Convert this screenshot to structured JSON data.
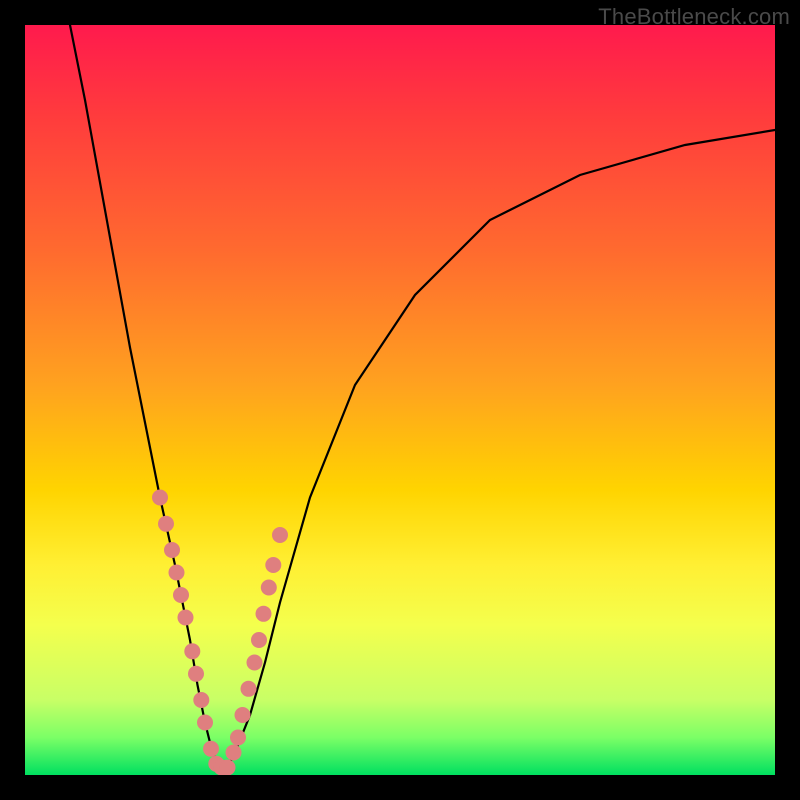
{
  "watermark": "TheBottleneck.com",
  "chart_data": {
    "type": "line",
    "title": "",
    "xlabel": "",
    "ylabel": "",
    "xlim": [
      0,
      100
    ],
    "ylim": [
      0,
      100
    ],
    "series": [
      {
        "name": "bottleneck-curve",
        "x": [
          6,
          8,
          10,
          12,
          14,
          16,
          18,
          20,
          22,
          23,
          24,
          25,
          26,
          27,
          28,
          30,
          32,
          34,
          38,
          44,
          52,
          62,
          74,
          88,
          100
        ],
        "values": [
          100,
          90,
          79,
          68,
          57,
          47,
          37,
          28,
          18,
          12,
          7,
          3,
          1,
          1,
          3,
          8,
          15,
          23,
          37,
          52,
          64,
          74,
          80,
          84,
          86
        ]
      }
    ],
    "markers": {
      "name": "highlight-points",
      "color": "#df7f7f",
      "x": [
        18.0,
        18.8,
        19.6,
        20.2,
        20.8,
        21.4,
        22.3,
        22.8,
        23.5,
        24.0,
        24.8,
        25.5,
        26.2,
        27.0,
        27.8,
        28.4,
        29.0,
        29.8,
        30.6,
        31.2,
        31.8,
        32.5,
        33.1,
        34.0
      ],
      "values": [
        37.0,
        33.5,
        30.0,
        27.0,
        24.0,
        21.0,
        16.5,
        13.5,
        10.0,
        7.0,
        3.5,
        1.5,
        1.0,
        1.0,
        3.0,
        5.0,
        8.0,
        11.5,
        15.0,
        18.0,
        21.5,
        25.0,
        28.0,
        32.0
      ]
    },
    "colors": {
      "curve": "#000000",
      "marker": "#df7f7f",
      "gradient_top": "#ff1a4d",
      "gradient_bottom": "#00e060"
    }
  }
}
